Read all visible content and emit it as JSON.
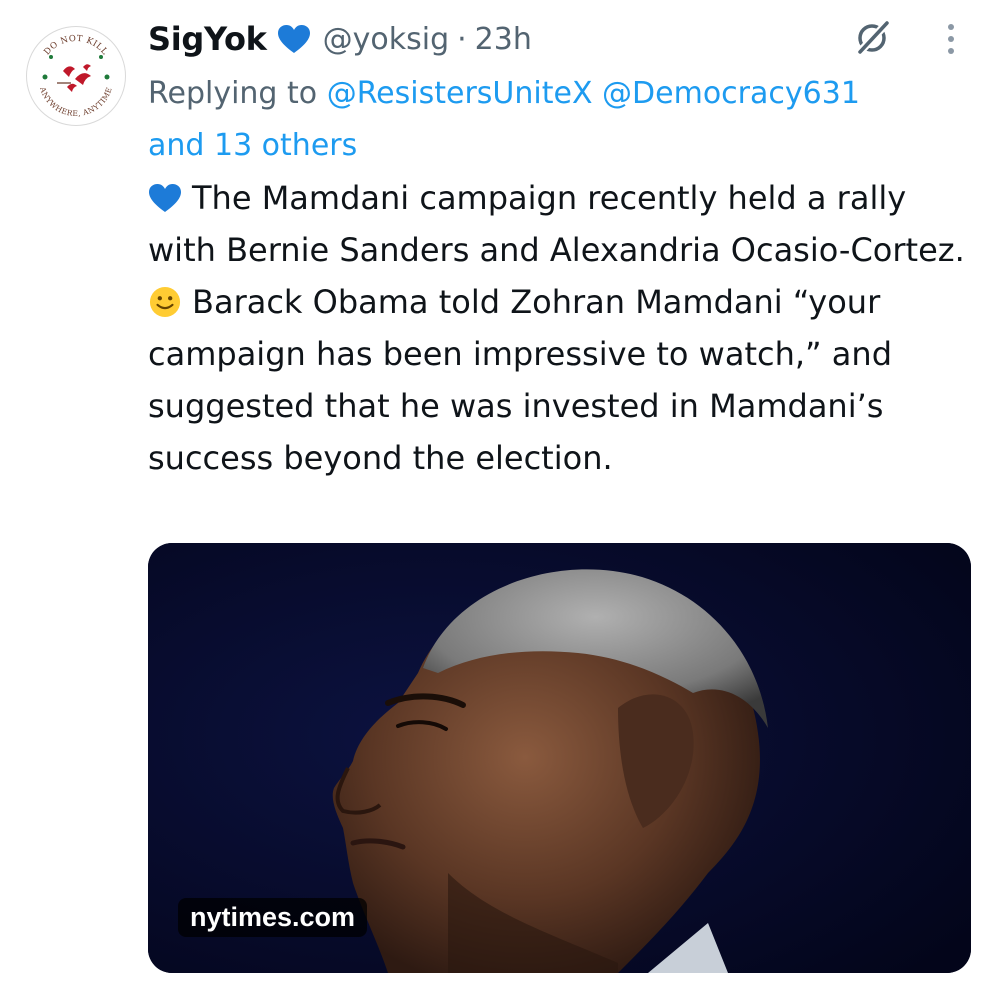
{
  "author": {
    "display_name": "SigYok",
    "handle": "@yoksig",
    "separator": "·",
    "timestamp": "23h",
    "avatar_text_top": "DO NOT KILL",
    "avatar_text_bottom": "ANYWHERE, ANYTIME"
  },
  "reply": {
    "prefix": "Replying to",
    "mentions": [
      "@ResistersUniteX",
      "@Democracy631"
    ],
    "others": "and 13 others"
  },
  "tweet": {
    "line1": "The Mamdani campaign recently held a rally with Bernie Sanders and Alexandria Ocasio-Cortez.",
    "line2": "Barack Obama told Zohran Mamdani “your campaign has been impressive to watch,” and suggested that he was invested in Mamdani’s success beyond the election."
  },
  "media": {
    "source": "nytimes.com"
  },
  "icons": {
    "verified": "blue-heart-icon",
    "grok": "grok-icon",
    "more": "more-icon",
    "emoji_heart": "blue-heart-emoji",
    "emoji_smile": "slightly-smiling-face-emoji"
  },
  "colors": {
    "accent": "#1d9bf0",
    "secondary_text": "#536471",
    "primary_text": "#0f1419",
    "heart": "#1d7bd8"
  }
}
